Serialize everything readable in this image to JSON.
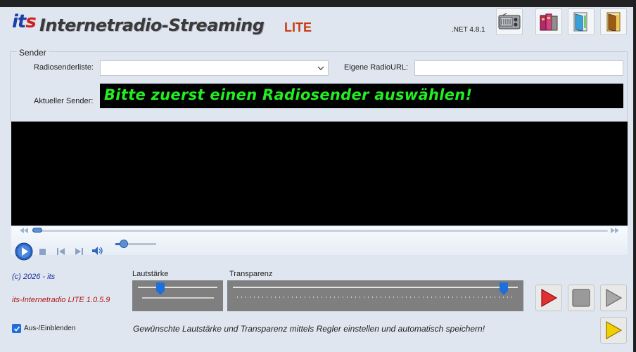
{
  "header": {
    "logo_main": "it",
    "logo_accent": "s",
    "app_title": "Internetradio-Streaming",
    "edition": "LITE",
    "framework": ".NET 4.8.1",
    "icons": [
      "radio-icon",
      "books-icon",
      "door-open-icon",
      "door-exit-icon"
    ]
  },
  "sender": {
    "group_label": "Sender",
    "list_label": "Radiosenderliste:",
    "list_value": "",
    "url_label": "Eigene RadioURL:",
    "url_value": "",
    "current_label": "Aktueller Sender:",
    "current_text": "Bitte zuerst einen Radiosender auswählen!"
  },
  "player": {
    "seek_progress": 0.0,
    "volume_level": 0.2
  },
  "footer": {
    "copyright": "(c) 2026 - its",
    "version": "its-Internetradio LITE 1.0.5.9",
    "volume_label": "Lautstärke",
    "volume_level": 0.28,
    "transparency_label": "Transparenz",
    "transparency_level": 0.95,
    "toggle_label": "Aus-/Einblenden",
    "toggle_checked": true,
    "hint": "Gewünschte Lautstärke und Transparenz mittels Regler einstellen und automatisch speichern!"
  },
  "colors": {
    "display_text": "#22ee22",
    "edition": "#c83c14",
    "play_red": "#e03030",
    "play_yellow": "#f0d000",
    "accent_blue": "#1e6fd9"
  }
}
